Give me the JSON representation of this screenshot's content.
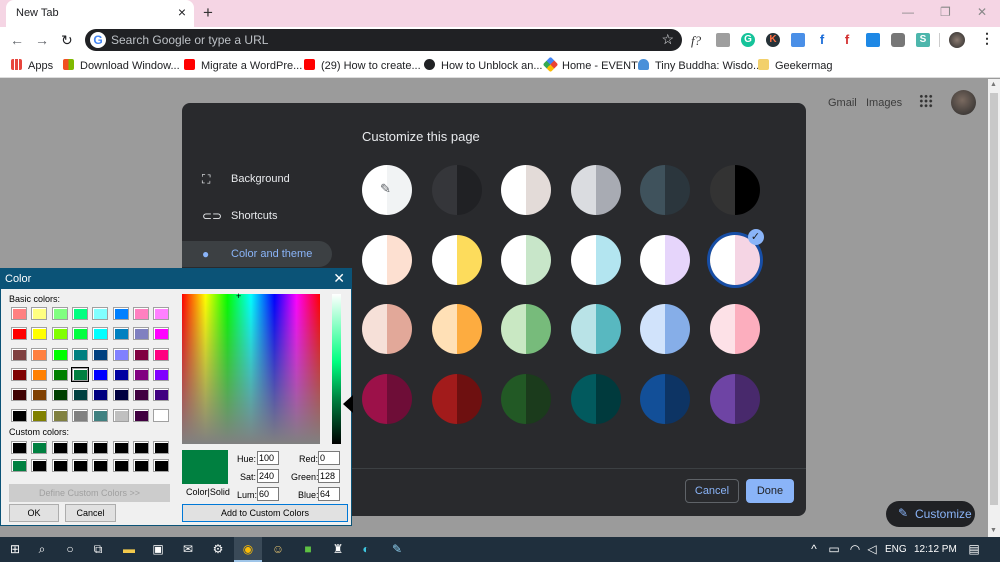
{
  "browser": {
    "tab_title": "New Tab",
    "tab_close": "×",
    "new_tab": "+",
    "window_controls": {
      "minimize": "—",
      "restore": "❐",
      "close": "✕"
    },
    "omnibox_placeholder": "Search Google or type a URL",
    "extensions": [
      "f?",
      "camera",
      "G",
      "K",
      "calendar",
      "f",
      "f",
      "cast",
      "tv",
      "S"
    ],
    "bookmarks": [
      {
        "label": "Apps",
        "icon": "apps-grid-icon",
        "color": "#e8453c"
      },
      {
        "label": "Download Window...",
        "icon": "windows-logo-icon",
        "color": "#f25022"
      },
      {
        "label": "Migrate a WordPre...",
        "icon": "youtube-icon",
        "color": "#ff0000"
      },
      {
        "label": "(29) How to create...",
        "icon": "youtube-icon",
        "color": "#ff0000"
      },
      {
        "label": "How to Unblock an...",
        "icon": "globe-icon",
        "color": "#202124"
      },
      {
        "label": "Home - EVENT",
        "icon": "event-icon",
        "color": "#34a853"
      },
      {
        "label": "Tiny Buddha: Wisdo...",
        "icon": "buddha-icon",
        "color": "#4a90d9"
      },
      {
        "label": "Geekermag",
        "icon": "folder-icon",
        "color": "#f2d06b"
      }
    ]
  },
  "page": {
    "gmail": "Gmail",
    "images": "Images",
    "customize_button": "Customize"
  },
  "customize": {
    "heading": "Customize this page",
    "sidebar": [
      {
        "label": "Background",
        "icon": "image-icon",
        "active": false
      },
      {
        "label": "Shortcuts",
        "icon": "link-icon",
        "active": false
      },
      {
        "label": "Color and theme",
        "icon": "palette-icon",
        "active": true
      }
    ],
    "swatches": [
      [
        [
          "#ffffff",
          "#f1f3f4"
        ],
        [
          "#35363a",
          "#202124"
        ],
        [
          "#ffffff",
          "#e3dbd8"
        ],
        [
          "#dadce0",
          "#a8abb3"
        ],
        [
          "#3f525c",
          "#2b363d"
        ],
        [
          "#333333",
          "#000000"
        ]
      ],
      [
        [
          "#ffffff",
          "#fde0d1"
        ],
        [
          "#ffffff",
          "#fddc5c"
        ],
        [
          "#ffffff",
          "#c8e6c9"
        ],
        [
          "#ffffff",
          "#b3e5f0"
        ],
        [
          "#ffffff",
          "#e6d5fb"
        ],
        [
          "#ffffff",
          "#f5d5e4"
        ]
      ],
      [
        [
          "#f6e0d8",
          "#e2a899"
        ],
        [
          "#ffe0b6",
          "#fdac40"
        ],
        [
          "#c9e8c3",
          "#77bb7b"
        ],
        [
          "#b9e3e7",
          "#58b8c0"
        ],
        [
          "#d1e3fb",
          "#86aee8"
        ],
        [
          "#fde1e7",
          "#fcaebe"
        ]
      ],
      [
        [
          "#9c1149",
          "#6e0d37"
        ],
        [
          "#a21b1b",
          "#6e1010"
        ],
        [
          "#225925",
          "#1b3b1c"
        ],
        [
          "#025a5e",
          "#003a3d"
        ],
        [
          "#124f98",
          "#0d3464"
        ],
        [
          "#6e44a4",
          "#48296c"
        ]
      ]
    ],
    "selected_swatch": [
      1,
      5
    ],
    "cancel": "Cancel",
    "done": "Done"
  },
  "color_dialog": {
    "title": "Color",
    "basic_colors_label": "Basic colors:",
    "basic_colors": [
      [
        "#ff8080",
        "#ffff80",
        "#80ff80",
        "#00ff80",
        "#80ffff",
        "#0080ff",
        "#ff80c0",
        "#ff80ff"
      ],
      [
        "#ff0000",
        "#ffff00",
        "#80ff00",
        "#00ff40",
        "#00ffff",
        "#0080c0",
        "#8080c0",
        "#ff00ff"
      ],
      [
        "#804040",
        "#ff8040",
        "#00ff00",
        "#008080",
        "#004080",
        "#8080ff",
        "#800040",
        "#ff0080"
      ],
      [
        "#800000",
        "#ff8000",
        "#008000",
        "#008040",
        "#0000ff",
        "#0000a0",
        "#800080",
        "#8000ff"
      ],
      [
        "#400000",
        "#804000",
        "#004000",
        "#004040",
        "#000080",
        "#000040",
        "#400040",
        "#400080"
      ],
      [
        "#000000",
        "#808000",
        "#808040",
        "#808080",
        "#408080",
        "#c0c0c0",
        "#400040",
        "#ffffff"
      ]
    ],
    "selected_basic": [
      3,
      3
    ],
    "custom_colors_label": "Custom colors:",
    "custom_colors": [
      [
        "#000000",
        "#008040",
        "#000000",
        "#000000",
        "#000000",
        "#000000",
        "#000000",
        "#000000"
      ],
      [
        "#008040",
        "#000000",
        "#000000",
        "#000000",
        "#000000",
        "#000000",
        "#000000",
        "#000000"
      ]
    ],
    "define_custom": "Define Custom Colors >>",
    "ok": "OK",
    "cancel": "Cancel",
    "color_solid": "Color|Solid",
    "hue_label": "Hue:",
    "hue": "100",
    "sat_label": "Sat:",
    "sat": "240",
    "lum_label": "Lum:",
    "lum": "60",
    "red_label": "Red:",
    "red": "0",
    "green_label": "Green:",
    "green": "128",
    "blue_label": "Blue:",
    "blue": "64",
    "add_custom": "Add to Custom Colors",
    "current_color": "#008040"
  },
  "taskbar": {
    "language": "ENG",
    "time": "12:12 PM"
  }
}
